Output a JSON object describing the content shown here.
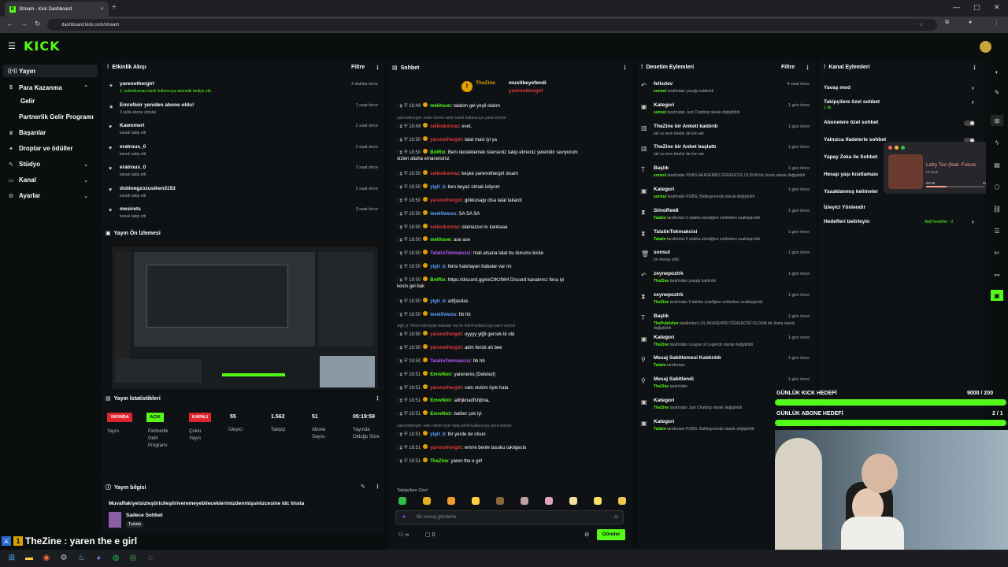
{
  "browser": {
    "tab_title": "Stream - Kick Dashboard",
    "url": "dashboard.kick.com/stream"
  },
  "app": {
    "logo": "KICK"
  },
  "sidebar": {
    "items": [
      {
        "label": "Yayın",
        "icon": "broadcast-icon"
      },
      {
        "label": "Para Kazanma",
        "icon": "money-icon"
      },
      {
        "label": "Gelir",
        "icon": ""
      },
      {
        "label": "Partnerlik Gelir Programı",
        "icon": ""
      },
      {
        "label": "Başarılar",
        "icon": "trophy-icon"
      },
      {
        "label": "Droplar ve ödüller",
        "icon": "gift-icon"
      },
      {
        "label": "Stüdyo",
        "icon": "studio-icon"
      },
      {
        "label": "Kanal",
        "icon": "channel-icon"
      },
      {
        "label": "Ayarlar",
        "icon": "settings-icon"
      }
    ]
  },
  "activity": {
    "title": "Etkinlik Akışı",
    "filter": "Filtre",
    "rows": [
      {
        "title": "yarenothergirl",
        "sub": "1. selimdurmaz isimli kullanıcıya abonelik hediye etti.",
        "time": "4 dakika önce",
        "icon": "gift-icon",
        "green": true
      },
      {
        "title": "EmreNoir yeniden abone oldu!",
        "sub": "3 aylık abone oldular",
        "time": "1 saat önce",
        "icon": "star-icon",
        "green": false
      },
      {
        "title": "Kawnmert",
        "sub": "kanalı takip etti",
        "time": "2 saat önce",
        "icon": "heart-icon",
        "green": false
      },
      {
        "title": "eratrous_0",
        "sub": "kanalı takip etti",
        "time": "2 saat önce",
        "icon": "heart-icon",
        "green": false
      },
      {
        "title": "eratrous_0",
        "sub": "kanalı takip etti",
        "time": "2 saat önce",
        "icon": "heart-icon",
        "green": false
      },
      {
        "title": "dobloegzozusiken3153",
        "sub": "kanalı takip etti",
        "time": "2 saat önce",
        "icon": "heart-icon",
        "green": false
      },
      {
        "title": "mesirets",
        "sub": "kanalı takip etti",
        "time": "3 saat önce",
        "icon": "heart-icon",
        "green": false
      }
    ]
  },
  "preview": {
    "title": "Yayın Ön İzlemesi"
  },
  "stats": {
    "title": "Yayın İstatistikleri",
    "badges": [
      {
        "text": "YAYINDA",
        "label": "Yayın",
        "color": "#e0242f"
      },
      {
        "text": "AÇIK",
        "label": "Partnerlik Gelir Programı",
        "color": "#53fc18"
      },
      {
        "text": "KAPALI",
        "label": "Çoklu Yayın",
        "color": "#e0242f"
      }
    ],
    "values": [
      {
        "value": "55",
        "label": "İzleyici"
      },
      {
        "value": "1.562",
        "label": "Takipçi"
      },
      {
        "value": "51",
        "label": "Abone Sayısı"
      },
      {
        "value": "05:19:59",
        "label": "Yayında Olduğu Süre"
      }
    ]
  },
  "info": {
    "title": "Yayın bilgisi",
    "stream_title": "Muvaffakiyetsizleştiricileştiriveremeyebileceklerimizdenmişsinizcesine ldc linsta",
    "category": "Sadece Sohbet",
    "tag": "Turkish"
  },
  "overlay_chat": "TheZine : yaren the e girl",
  "chat": {
    "title": "Sohbet",
    "pinned": {
      "user1": "TheZine",
      "user2": "mustibeyefendi",
      "user3": "yarenothergirl"
    },
    "messages": [
      {
        "kind": "msg",
        "time": "18:49",
        "user": "melihson",
        "color": "#53fc18",
        "text": "talatım gel yeşil olalım"
      },
      {
        "kind": "reply",
        "text": "yarenothergirl: selim özenti selim isimli kullanıcıya yanıt veriyor"
      },
      {
        "kind": "msg",
        "time": "18:49",
        "user": "selimdurmaz",
        "color": "#e03a3a",
        "text": "evet."
      },
      {
        "kind": "msg",
        "time": "18:50",
        "user": "yarenothergirl",
        "color": "#e03a3a",
        "text": "talat mavi iyi ya"
      },
      {
        "kind": "msg",
        "time": "18:50",
        "user": "BotRix",
        "color": "#53fc18",
        "text": "Beni desteklemek isterseniz takip etmeniz yeterlidir seviyorum"
      },
      {
        "kind": "cont",
        "text": "sizleri allaha emanetsiniz"
      },
      {
        "kind": "msg",
        "time": "18:50",
        "user": "selimdurmaz",
        "color": "#e03a3a",
        "text": "keşke yarenothergirl olsam"
      },
      {
        "kind": "msg",
        "time": "18:50",
        "user": "yigit_b",
        "color": "#5aa0ff",
        "text": "ben beyaz olmak istiyom"
      },
      {
        "kind": "msg",
        "time": "18:50",
        "user": "yarenothergirl",
        "color": "#e03a3a",
        "text": "gökkusagı olsa talat takardı"
      },
      {
        "kind": "msg",
        "time": "18:50",
        "user": "leeelifwwss",
        "color": "#5aa0ff",
        "text": "SA SA SA"
      },
      {
        "kind": "msg",
        "time": "18:50",
        "user": "selimdurmaz",
        "color": "#e03a3a",
        "text": "olamazsın kı kankaaa"
      },
      {
        "kind": "msg",
        "time": "18:50",
        "user": "melihson",
        "color": "#53fc18",
        "text": "ase ase"
      },
      {
        "kind": "msg",
        "time": "18:50",
        "user": "TalatinTokmakcisi",
        "color": "#b25aff",
        "text": "mali atsana talat bu durumu kicke"
      },
      {
        "kind": "msg",
        "time": "18:50",
        "user": "yigit_b",
        "color": "#5aa0ff",
        "text": "ferisi hatırlayan babalar var mı"
      },
      {
        "kind": "msg",
        "time": "18:50",
        "user": "BotRix",
        "color": "#53fc18",
        "text": "https://discord.gg/exCtKzfW4 Discord kanalımız fena iyi"
      },
      {
        "kind": "cont",
        "text": "kesin gel bak"
      },
      {
        "kind": "msg",
        "time": "18:50",
        "user": "yigit_b",
        "color": "#5aa0ff",
        "text": "adfjasdas"
      },
      {
        "kind": "msg",
        "time": "18:50",
        "user": "leeelifwwss",
        "color": "#5aa0ff",
        "text": "hb hb"
      },
      {
        "kind": "reply",
        "text": "yigit_b: ferisi hatırlayan babalar var mı isimli kullanıcıya yanıt veriyor"
      },
      {
        "kind": "msg",
        "time": "18:50",
        "user": "yarenothergirl",
        "color": "#e03a3a",
        "text": "oyyyy yiğit gercek bi old"
      },
      {
        "kind": "msg",
        "time": "18:50",
        "user": "yarenothergirl",
        "color": "#e03a3a",
        "text": "adm feristi ah bee"
      },
      {
        "kind": "msg",
        "time": "18:50",
        "user": "TalatinTokmakcisi",
        "color": "#b25aff",
        "text": "hb hb"
      },
      {
        "kind": "msg",
        "time": "18:51",
        "user": "EmreNoir",
        "color": "#53fc18",
        "text": "yarenenis (Deleted)"
      },
      {
        "kind": "msg",
        "time": "18:51",
        "user": "yarenothergirl",
        "color": "#e03a3a",
        "text": "valo nickim öyle hala"
      },
      {
        "kind": "msg",
        "time": "18:51",
        "user": "EmreNoir",
        "color": "#53fc18",
        "text": "adhjknadfshjbna,"
      },
      {
        "kind": "msg",
        "time": "18:51",
        "user": "EmreNoir",
        "color": "#53fc18",
        "text": "batlıer çok iyi"
      },
      {
        "kind": "reply",
        "text": "yarenothergirl: valo nickim öyle hala isimli kullanıcıya yanıt veriyor"
      },
      {
        "kind": "msg",
        "time": "18:51",
        "user": "yigit_b",
        "color": "#5aa0ff",
        "text": "bir yerde de olsun"
      },
      {
        "kind": "msg",
        "time": "18:51",
        "user": "yarenothergirl",
        "color": "#e03a3a",
        "text": "emrre benle tasuku takılgeclo"
      },
      {
        "kind": "msg",
        "time": "18:51",
        "user": "TheZine",
        "color": "#53fc18",
        "text": "yaren the e girl"
      }
    ],
    "followers_only": "Takipçilere Özel",
    "placeholder": "Bir mesaj gönderin",
    "send": "Gönder",
    "count_a": "∞",
    "count_b": "0"
  },
  "moderation": {
    "title": "Denetim Eylemleri",
    "filter": "Filtre",
    "rows": [
      {
        "title": "felixdev",
        "sub_user": "sonsul",
        "sub": "tarafından yasağı kaldırıldı",
        "time": "4 saat önce",
        "icon": "undo-icon"
      },
      {
        "title": "Kategori",
        "sub_user": "sonsul",
        "sub": "tarafından Just Chatting olarak değiştirildi",
        "time": "1 gün önce",
        "icon": "category-icon"
      },
      {
        "title": "TheZine bir Anketi kaldırdı",
        "sub_user": "",
        "sub": "talt vs eren birebir de kim akr",
        "time": "1 gün önce",
        "icon": "poll-icon"
      },
      {
        "title": "TheZine bir Anket başlattı",
        "sub_user": "",
        "sub": "talt vs eren birebir de kim akr",
        "time": "1 gün önce",
        "icon": "poll-icon"
      },
      {
        "title": "Başlık",
        "sub_user": "sonsul",
        "sub": "tarafından PUBG AKADEMİSİ ÖĞRENCİSİ OLDUM ldc linsta olarak değiştirildi",
        "time": "1 gün önce",
        "icon": "title-icon"
      },
      {
        "title": "Kategori",
        "sub_user": "sonsul",
        "sub": "tarafından PUBG: Battlegrounds olarak değiştirildi",
        "time": "1 gün önce",
        "icon": "category-icon"
      },
      {
        "title": "SimoRee8",
        "sub_user": "Talatin",
        "sub": "tarafından 5 dakika süreliğine sohbetten uzaklaştırıldı",
        "time": "1 gün önce",
        "icon": "timeout-icon"
      },
      {
        "title": "TalatinTokmakcisi",
        "sub_user": "Talatin",
        "sub": "tarafından 5 dakika süreliğine sohbetten uzaklaştırıldı",
        "time": "1 gün önce",
        "icon": "timeout-icon"
      },
      {
        "title": "sonsul",
        "sub_user": "",
        "sub": "bir mesajı sildi",
        "time": "1 gün önce",
        "icon": "trash-icon"
      },
      {
        "title": "zeynepoztrk",
        "sub_user": "TheZine",
        "sub": "tarafından yasağı kaldırıldı",
        "time": "1 gün önce",
        "icon": "undo-icon"
      },
      {
        "title": "zeynepoztrk",
        "sub_user": "TheZine",
        "sub": "tarafından 5 dakika süreliğine sohbetten uzaklaştırıldı",
        "time": "1 gün önce",
        "icon": "timeout-icon"
      },
      {
        "title": "Başlık",
        "sub_user": "ThePublisher",
        "sub": "tarafından LOL AKADEMİSİ ÖĞRENCİSİ OLDUM ldc linsta olarak değiştirildi",
        "time": "1 gün önce",
        "icon": "title-icon"
      },
      {
        "title": "Kategori",
        "sub_user": "TheZine",
        "sub": "tarafından League of Legends olarak değiştirildi",
        "time": "1 gün önce",
        "icon": "category-icon"
      },
      {
        "title": "Mesaj Sabitlemesi Kaldırıldı",
        "sub_user": "Talatin",
        "sub": "tarafından",
        "time": "1 gün önce",
        "icon": "unpin-icon"
      },
      {
        "title": "Mesaj Sabitlendi",
        "sub_user": "TheZine",
        "sub": "tarafından",
        "time": "1 gün önce",
        "icon": "pin-icon"
      },
      {
        "title": "Kategori",
        "sub_user": "TheZine",
        "sub": "tarafından Just Chatting olarak değiştirildi",
        "time": "1 gün önce",
        "icon": "category-icon"
      },
      {
        "title": "Kategori",
        "sub_user": "Talatin",
        "sub": "tarafından PUBG: Battlegrounds olarak değiştirildi",
        "time": "1 gün önce",
        "icon": "category-icon"
      }
    ]
  },
  "channel_actions": {
    "title": "Kanal Eylemleri",
    "items": [
      {
        "label": "Yavaş mod",
        "sub": "",
        "control": "arrow"
      },
      {
        "label": "Takipçilere özel sohbet",
        "sub": "1 dk.",
        "control": "arrow"
      },
      {
        "label": "Abonelere özel sohbet",
        "sub": "",
        "control": "toggle"
      },
      {
        "label": "Yalnızca ifadelerle sohbet",
        "sub": "",
        "control": "toggle"
      },
      {
        "label": "Yapay Zeka ile Sohbet",
        "sub": "",
        "control": ""
      },
      {
        "label": "Hesap yaşı kısıtlaması",
        "sub": "",
        "control": ""
      },
      {
        "label": "Yasaklanmış kelimeler",
        "sub": "",
        "control": ""
      },
      {
        "label": "İzleyici Yönlendir",
        "sub": "",
        "control": ""
      },
      {
        "label": "Hedefleri belirleyin",
        "sub": "Aktif hedefler - 2",
        "control": "arrow"
      }
    ]
  },
  "music": {
    "title": "Letty Too (feat. Future",
    "artist": "Lil Durk",
    "elapsed": "00:55",
    "total": "02:39"
  },
  "goals": [
    {
      "label": "GÜNLÜK KICK HEDEFİ",
      "value": "9000 / 200",
      "fraction": 1.0
    },
    {
      "label": "GÜNLÜK ABONE HEDEFİ",
      "value": "2 / 1",
      "fraction": 1.0
    }
  ],
  "colors": {
    "accent": "#53fc18",
    "live": "#e0242f",
    "panel": "#0f1214"
  }
}
